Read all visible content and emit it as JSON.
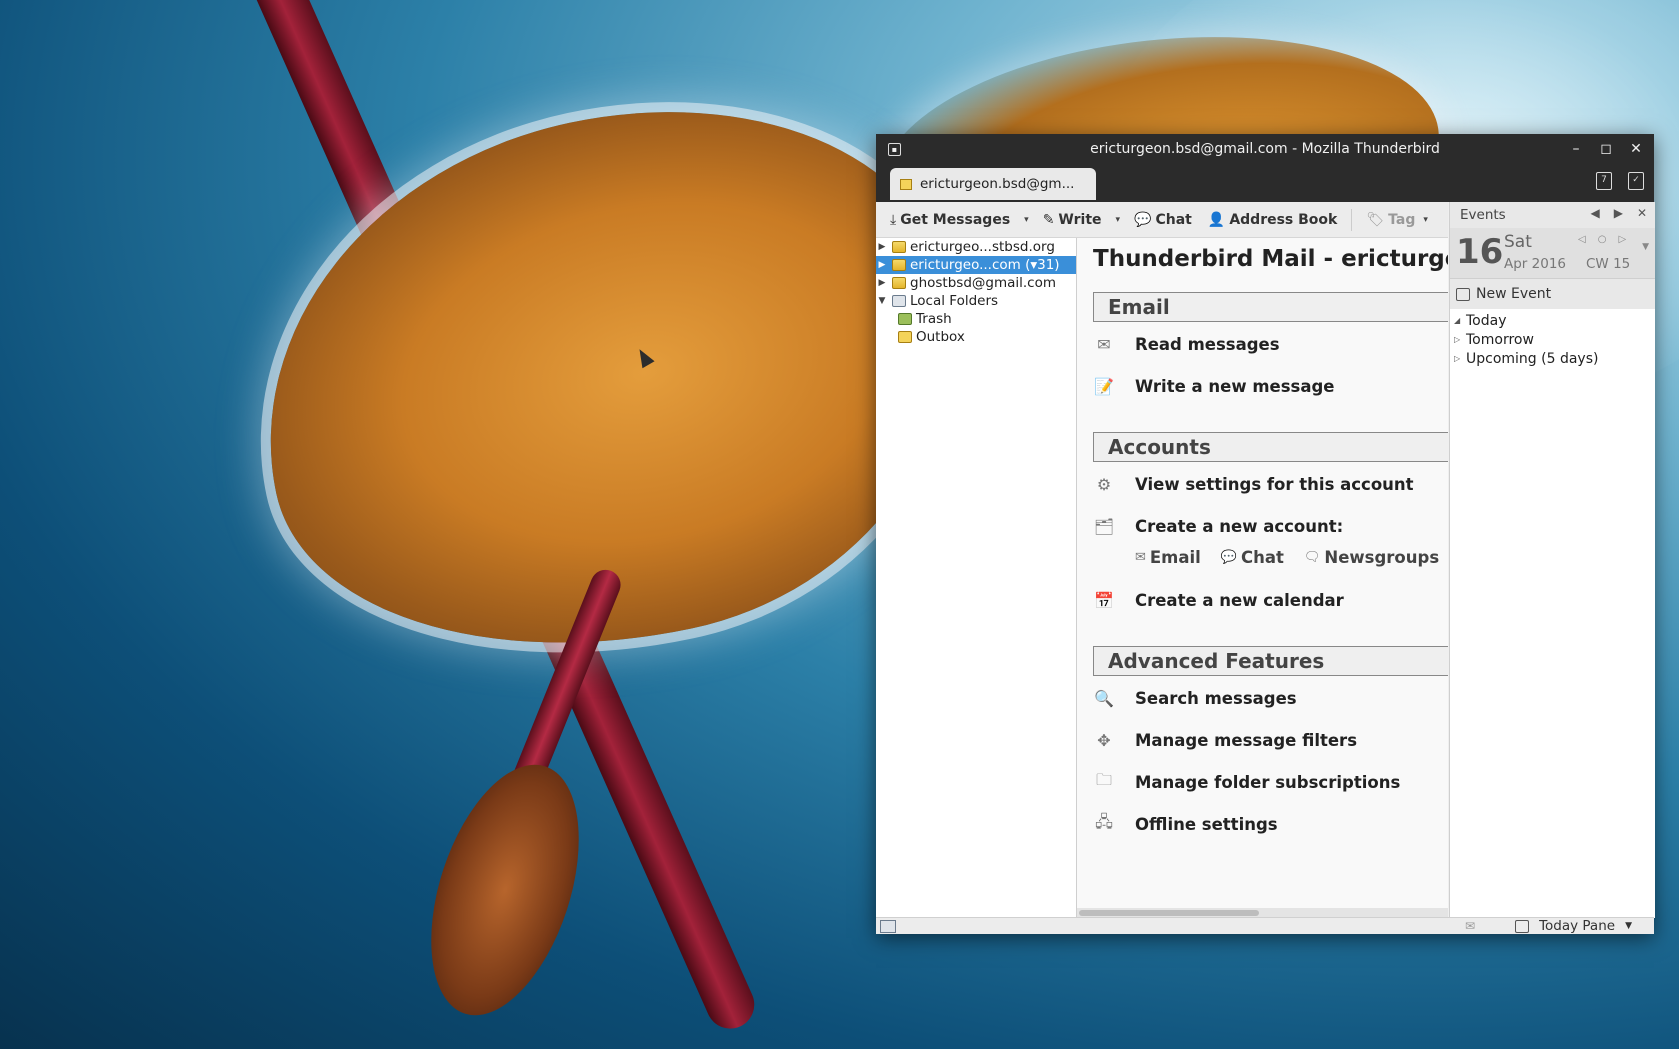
{
  "window": {
    "title": "ericturgeon.bsd@gmail.com - Mozilla Thunderbird",
    "menu_glyph": "▪",
    "minimize": "–",
    "maximize": "◻",
    "close": "✕"
  },
  "tab": {
    "label": "ericturgeon.bsd@gm..."
  },
  "toolbar": {
    "get_messages": "Get Messages",
    "write": "Write",
    "chat": "Chat",
    "address_book": "Address Book",
    "tag": "Tag",
    "dropdown_glyph": "▾"
  },
  "folders": [
    {
      "label": "ericturgeo...stbsd.org",
      "twisty": "▶",
      "type": "acct",
      "selected": false
    },
    {
      "label": "ericturgeo...com (▾31)",
      "twisty": "▶",
      "type": "acct-lock",
      "selected": true
    },
    {
      "label": "ghostbsd@gmail.com",
      "twisty": "▶",
      "type": "acct-lock",
      "selected": false
    },
    {
      "label": "Local Folders",
      "twisty": "▼",
      "type": "local",
      "selected": false
    },
    {
      "label": "Trash",
      "twisty": "",
      "type": "trash",
      "selected": false
    },
    {
      "label": "Outbox",
      "twisty": "",
      "type": "outbox",
      "selected": false
    }
  ],
  "content": {
    "heading": "Thunderbird Mail - ericturgeon.bsd@gmail.com",
    "email_section": "Email",
    "read_messages": "Read messages",
    "write_message": "Write a new message",
    "accounts_section": "Accounts",
    "view_settings": "View settings for this account",
    "create_account": "Create a new account:",
    "sub_email": "Email",
    "sub_chat": "Chat",
    "sub_newsgroups": "Newsgroups",
    "create_calendar": "Create a new calendar",
    "advanced_section": "Advanced Features",
    "search_messages": "Search messages",
    "manage_filters": "Manage message filters",
    "manage_subscriptions": "Manage folder subscriptions",
    "offline_settings": "Offline settings"
  },
  "today_pane": {
    "header": "Events",
    "day_number": "16",
    "day_of_week": "Sat",
    "month_year": "Apr 2016",
    "calendar_week": "CW 15",
    "new_event": "New Event",
    "agenda": [
      {
        "label": "Today",
        "twisty": "◢"
      },
      {
        "label": "Tomorrow",
        "twisty": "▷"
      },
      {
        "label": "Upcoming (5 days)",
        "twisty": "▷"
      }
    ]
  },
  "statusbar": {
    "today_pane_label": "Today Pane"
  }
}
